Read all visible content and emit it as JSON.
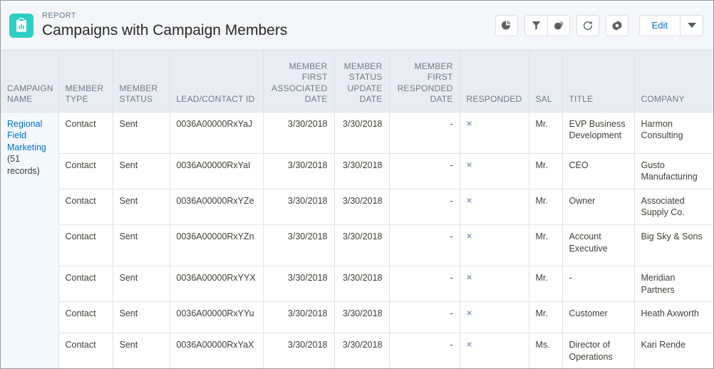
{
  "header": {
    "eyebrow": "REPORT",
    "title": "Campaigns with Campaign Members",
    "icon": "report-clipboard-chart-icon",
    "icon_color": "#2ecfc4",
    "actions": {
      "chart_label": "chart-icon",
      "filter_label": "filter-icon",
      "conditional_format_label": "conditional-formatting-icon",
      "refresh_label": "refresh-icon",
      "settings_label": "gear-icon",
      "edit_label": "Edit",
      "edit_menu_label": "chevron-down-icon"
    }
  },
  "table": {
    "columns": [
      {
        "label": "CAMPAIGN NAME",
        "align": "left"
      },
      {
        "label": "MEMBER TYPE",
        "align": "left"
      },
      {
        "label": "MEMBER STATUS",
        "align": "left"
      },
      {
        "label": "LEAD/CONTACT ID",
        "align": "left"
      },
      {
        "label": "MEMBER FIRST ASSOCIATED DATE",
        "align": "right"
      },
      {
        "label": "MEMBER STATUS UPDATE DATE",
        "align": "right"
      },
      {
        "label": "MEMBER FIRST RESPONDED DATE",
        "align": "right"
      },
      {
        "label": "RESPONDED",
        "align": "left"
      },
      {
        "label": "SAL",
        "align": "left"
      },
      {
        "label": "TITLE",
        "align": "left"
      },
      {
        "label": "COMPANY",
        "align": "left"
      }
    ],
    "group": {
      "name": "Regional Field Marketing",
      "record_count_label": "(51 records)"
    },
    "rows": [
      {
        "member_type": "Contact",
        "member_status": "Sent",
        "lead_contact_id": "0036A00000RxYaJ",
        "first_associated_date": "3/30/2018",
        "status_update_date": "3/30/2018",
        "first_responded_date": "-",
        "responded": "×",
        "sal": "Mr.",
        "title": "EVP Business Development",
        "company": "Harmon Consulting"
      },
      {
        "member_type": "Contact",
        "member_status": "Sent",
        "lead_contact_id": "0036A00000RxYaI",
        "first_associated_date": "3/30/2018",
        "status_update_date": "3/30/2018",
        "first_responded_date": "-",
        "responded": "×",
        "sal": "Mr.",
        "title": "CEO",
        "company": "Gusto Manufacturing"
      },
      {
        "member_type": "Contact",
        "member_status": "Sent",
        "lead_contact_id": "0036A00000RxYZe",
        "first_associated_date": "3/30/2018",
        "status_update_date": "3/30/2018",
        "first_responded_date": "-",
        "responded": "×",
        "sal": "Mr.",
        "title": "Owner",
        "company": "Associated Supply Co."
      },
      {
        "member_type": "Contact",
        "member_status": "Sent",
        "lead_contact_id": "0036A00000RxYZn",
        "first_associated_date": "3/30/2018",
        "status_update_date": "3/30/2018",
        "first_responded_date": "-",
        "responded": "×",
        "sal": "Mr.",
        "title": "Account Executive",
        "company": "Big Sky & Sons"
      },
      {
        "member_type": "Contact",
        "member_status": "Sent",
        "lead_contact_id": "0036A00000RxYYX",
        "first_associated_date": "3/30/2018",
        "status_update_date": "3/30/2018",
        "first_responded_date": "-",
        "responded": "×",
        "sal": "Mr.",
        "title": "-",
        "company": "Meridian Partners"
      },
      {
        "member_type": "Contact",
        "member_status": "Sent",
        "lead_contact_id": "0036A00000RxYYu",
        "first_associated_date": "3/30/2018",
        "status_update_date": "3/30/2018",
        "first_responded_date": "-",
        "responded": "×",
        "sal": "Mr.",
        "title": "Customer",
        "company": "Heath Axworth"
      },
      {
        "member_type": "Contact",
        "member_status": "Sent",
        "lead_contact_id": "0036A00000RxYaX",
        "first_associated_date": "3/30/2018",
        "status_update_date": "3/30/2018",
        "first_responded_date": "-",
        "responded": "×",
        "sal": "Ms.",
        "title": "Director of Operations",
        "company": "Kari Rende"
      }
    ]
  }
}
